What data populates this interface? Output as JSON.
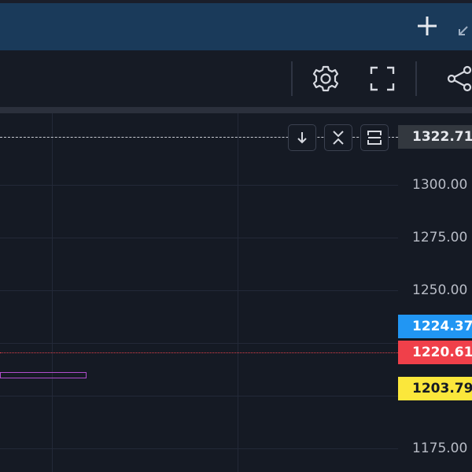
{
  "colors": {
    "background": "#151a24",
    "topbar": "#1a3a5a",
    "last_price_tag": "#33383f",
    "blue_tag": "#2196f3",
    "red_tag": "#f0404a",
    "yellow_tag": "#fbe73b",
    "dashed_line": "#c9ccd3",
    "red_dotted_line": "#e0404a",
    "purple_box": "#b04ccc"
  },
  "icons": {
    "add": "plus-icon",
    "shrink": "shrink-arrows-icon",
    "settings": "gear-icon",
    "fullscreen": "fullscreen-icon",
    "share": "share-icon",
    "scroll_down": "arrow-down-icon",
    "collapse": "collapse-icon",
    "fit": "fit-screen-icon"
  },
  "price_axis": {
    "ticks": [
      "1300.00",
      "1275.00",
      "1250.00",
      "1175.00"
    ]
  },
  "price_tags": {
    "top": "1322.71",
    "blue": "1224.37",
    "red": "1220.61",
    "yellow": "1203.79"
  }
}
